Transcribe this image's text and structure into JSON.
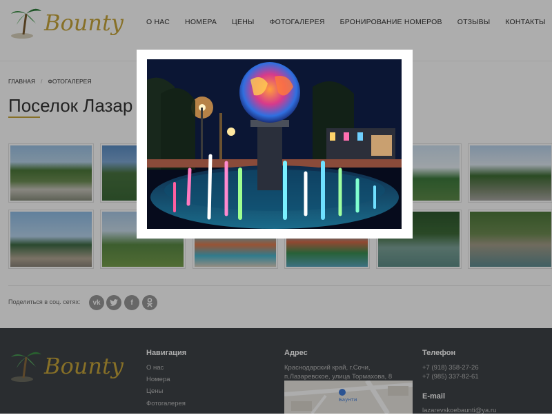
{
  "header": {
    "logo_text": "Bounty",
    "nav": [
      "О нас",
      "Номера",
      "Цены",
      "Фотогалерея",
      "Бронирование номеров",
      "Отзывы",
      "Контакты"
    ]
  },
  "breadcrumb": {
    "home": "Главная",
    "current": "Фотогалерея"
  },
  "page_title": "Поселок Лазар",
  "share": {
    "label": "Поделиться в соц. сетях:",
    "networks": [
      "vk-icon",
      "twitter-icon",
      "facebook-icon",
      "odnoklassniki-icon"
    ]
  },
  "footer": {
    "logo_text": "Bounty",
    "nav_heading": "Навигация",
    "nav_links": [
      "О нас",
      "Номера",
      "Цены",
      "Фотогалерея"
    ],
    "address_heading": "Адрес",
    "address_line1": "Краснодарский край, г.Сочи,",
    "address_line2": "п.Лазаревское, улица Тормахова, 8",
    "map_label": "Баунти",
    "phone_heading": "Телефон",
    "phones": [
      "+7 (918) 358-27-26",
      "+7 (985) 337-82-61"
    ],
    "email_heading": "E-mail",
    "email": "lazarevskoebaunti@ya.ru"
  },
  "colors": {
    "accent": "#c8a63a",
    "footer_bg": "#3e4348",
    "overlay": "rgba(0,0,0,0.32)"
  }
}
